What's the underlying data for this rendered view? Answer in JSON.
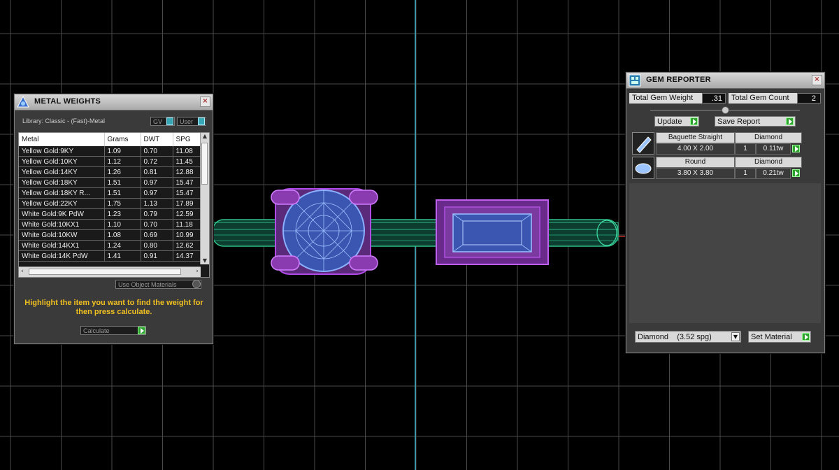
{
  "colors": {
    "grid": "#4a4a4a",
    "band": "#1a8f6a",
    "metal": "#8a3bb0",
    "stone": "#8ab0ff",
    "panel": "#3a3a3a",
    "hint": "#f0c020"
  },
  "metal_weights": {
    "title": "METAL WEIGHTS",
    "library_label": "Library: Classic - (Fast)-Metal",
    "gv_label": "GV",
    "user_label": "User",
    "columns": [
      "Metal",
      "Grams",
      "DWT",
      "SPG"
    ],
    "rows": [
      [
        "Yellow Gold:9KY",
        "1.09",
        "0.70",
        "11.08"
      ],
      [
        "Yellow Gold:10KY",
        "1.12",
        "0.72",
        "11.45"
      ],
      [
        "Yellow Gold:14KY",
        "1.26",
        "0.81",
        "12.88"
      ],
      [
        "Yellow Gold:18KY",
        "1.51",
        "0.97",
        "15.47"
      ],
      [
        "Yellow Gold:18KY R...",
        "1.51",
        "0.97",
        "15.47"
      ],
      [
        "Yellow Gold:22KY",
        "1.75",
        "1.13",
        "17.89"
      ],
      [
        "White Gold:9K PdW",
        "1.23",
        "0.79",
        "12.59"
      ],
      [
        "White Gold:10KX1",
        "1.10",
        "0.70",
        "11.18"
      ],
      [
        "White Gold:10KW",
        "1.08",
        "0.69",
        "10.99"
      ],
      [
        "White Gold:14KX1",
        "1.24",
        "0.80",
        "12.62"
      ],
      [
        "White Gold:14K PdW",
        "1.41",
        "0.91",
        "14.37"
      ]
    ],
    "use_object_materials": "Use Object Materials",
    "hint": "Highlight the item you want to find the weight for then press calculate.",
    "calculate_label": "Calculate"
  },
  "gem_reporter": {
    "title": "GEM REPORTER",
    "total_weight_label": "Total Gem Weight",
    "total_weight_value": ".31",
    "total_count_label": "Total Gem Count",
    "total_count_value": "2",
    "update_label": "Update",
    "save_report_label": "Save Report",
    "gems": [
      {
        "shape": "Baguette Straight",
        "material": "Diamond",
        "size": "4.00 X 2.00",
        "count": "1",
        "weight": "0.11tw",
        "icon": "baguette-gem-icon"
      },
      {
        "shape": "Round",
        "material": "Diamond",
        "size": "3.80 X 3.80",
        "count": "1",
        "weight": "0.21tw",
        "icon": "round-gem-icon"
      }
    ],
    "material_select": "Diamond    (3.52 spg)",
    "set_material_label": "Set Material"
  }
}
